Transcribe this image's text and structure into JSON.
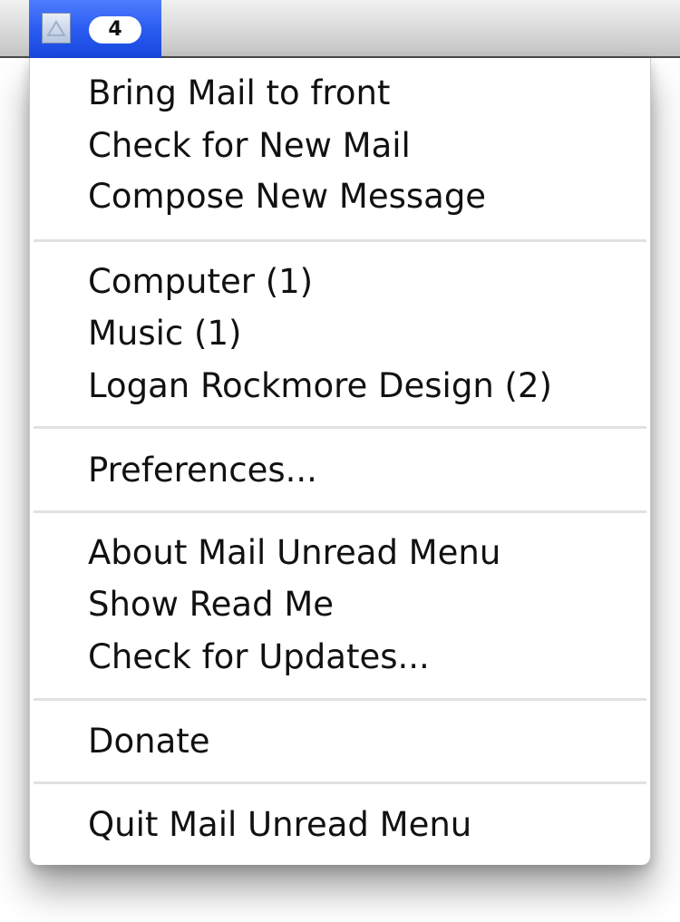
{
  "menubar": {
    "app_icon": "mail-app-icon",
    "badge_count": "4"
  },
  "menu": {
    "items": [
      "Bring Mail to front",
      "Check for New Mail",
      "Compose New Message",
      "Computer (1)",
      "Music (1)",
      "Logan Rockmore Design (2)",
      "Preferences...",
      "About Mail Unread Menu",
      "Show Read Me",
      "Check for Updates...",
      "Donate",
      "Quit Mail Unread Menu"
    ]
  }
}
